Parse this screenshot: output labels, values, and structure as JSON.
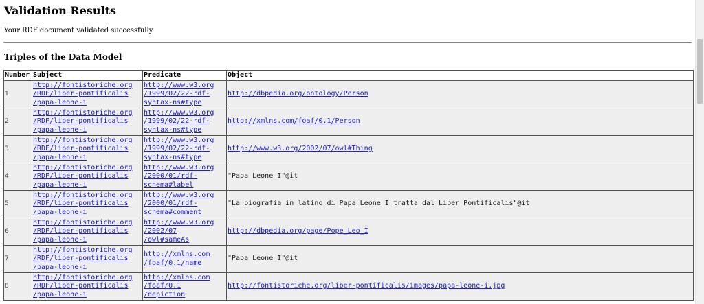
{
  "page": {
    "title": "Validation Results",
    "status_message": "Your RDF document validated successfully.",
    "section_title": "Triples of the Data Model"
  },
  "table": {
    "headers": [
      "Number",
      "Subject",
      "Predicate",
      "Object"
    ],
    "rows": [
      {
        "number": "1",
        "subject": "http://fontistoriche.org\n/RDF/liber-pontificalis\n/papa-leone-i",
        "predicate": "http://www.w3.org\n/1999/02/22-rdf-\nsyntax-ns#type",
        "object": "http://dbpedia.org/ontology/Person",
        "object_is_link": true
      },
      {
        "number": "2",
        "subject": "http://fontistoriche.org\n/RDF/liber-pontificalis\n/papa-leone-i",
        "predicate": "http://www.w3.org\n/1999/02/22-rdf-\nsyntax-ns#type",
        "object": "http://xmlns.com/foaf/0.1/Person",
        "object_is_link": true
      },
      {
        "number": "3",
        "subject": "http://fontistoriche.org\n/RDF/liber-pontificalis\n/papa-leone-i",
        "predicate": "http://www.w3.org\n/1999/02/22-rdf-\nsyntax-ns#type",
        "object": "http://www.w3.org/2002/07/owl#Thing",
        "object_is_link": true
      },
      {
        "number": "4",
        "subject": "http://fontistoriche.org\n/RDF/liber-pontificalis\n/papa-leone-i",
        "predicate": "http://www.w3.org\n/2000/01/rdf-\nschema#label",
        "object": "\"Papa Leone I\"@it",
        "object_is_link": false
      },
      {
        "number": "5",
        "subject": "http://fontistoriche.org\n/RDF/liber-pontificalis\n/papa-leone-i",
        "predicate": "http://www.w3.org\n/2000/01/rdf-\nschema#comment",
        "object": "\"La biografia in latino di Papa Leone I tratta dal Liber Pontificalis\"@it",
        "object_is_link": false
      },
      {
        "number": "6",
        "subject": "http://fontistoriche.org\n/RDF/liber-pontificalis\n/papa-leone-i",
        "predicate": "http://www.w3.org\n/2002/07\n/owl#sameAs",
        "object": "http://dbpedia.org/page/Pope_Leo_I",
        "object_is_link": true
      },
      {
        "number": "7",
        "subject": "http://fontistoriche.org\n/RDF/liber-pontificalis\n/papa-leone-i",
        "predicate": "http://xmlns.com\n/foaf/0.1/name",
        "object": "\"Papa Leone I\"@it",
        "object_is_link": false
      },
      {
        "number": "8",
        "subject": "http://fontistoriche.org\n/RDF/liber-pontificalis\n/papa-leone-i",
        "predicate": "http://xmlns.com\n/foaf/0.1\n/depiction",
        "object": "http://fontistoriche.org/liber-pontificalis/images/papa-leone-i.jpg",
        "object_is_link": true
      }
    ]
  },
  "colors": {
    "link": "#2020cc",
    "cell_background": "#eeeeee",
    "border": "#555555"
  }
}
